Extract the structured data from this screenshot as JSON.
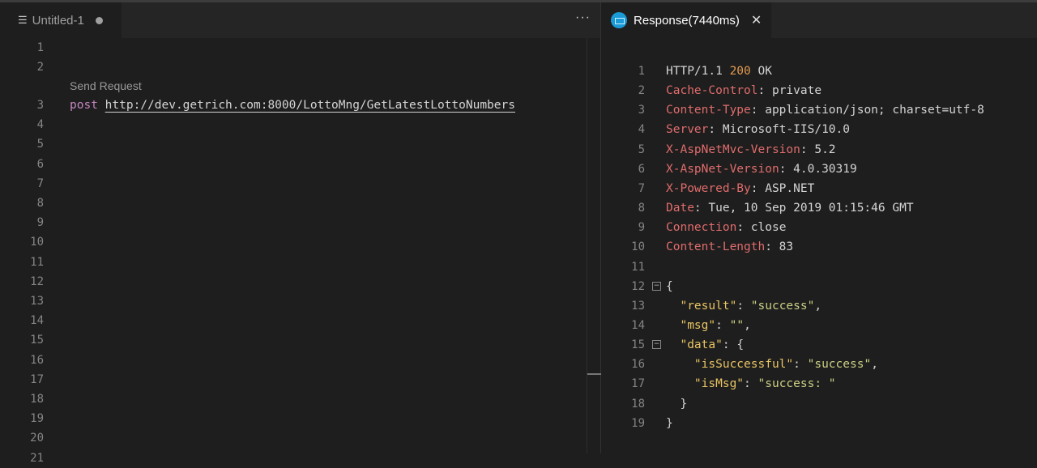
{
  "left_tab": {
    "title": "Untitled-1",
    "more": "···"
  },
  "right_tab": {
    "title": "Response(7440ms)",
    "close": "✕"
  },
  "editor": {
    "line_count": 21,
    "codelens": "Send Request",
    "method": "post",
    "url": "http://dev.getrich.com:8000/LottoMng/GetLatestLottoNumbers"
  },
  "response": {
    "lines": [
      [
        [
          "HTTP/1.1 ",
          "pl"
        ],
        [
          "200",
          "num"
        ],
        [
          " OK",
          "pl"
        ]
      ],
      [
        [
          "Cache-Control",
          "hdr"
        ],
        [
          ": private",
          "pl"
        ]
      ],
      [
        [
          "Content-Type",
          "hdr"
        ],
        [
          ": application/json; charset=utf-8",
          "pl"
        ]
      ],
      [
        [
          "Server",
          "hdr"
        ],
        [
          ": Microsoft-IIS/10.0",
          "pl"
        ]
      ],
      [
        [
          "X-AspNetMvc-Version",
          "hdr"
        ],
        [
          ": 5.2",
          "pl"
        ]
      ],
      [
        [
          "X-AspNet-Version",
          "hdr"
        ],
        [
          ": 4.0.30319",
          "pl"
        ]
      ],
      [
        [
          "X-Powered-By",
          "hdr"
        ],
        [
          ": ASP.NET",
          "pl"
        ]
      ],
      [
        [
          "Date",
          "hdr"
        ],
        [
          ": Tue, 10 Sep 2019 01:15:46 GMT",
          "pl"
        ]
      ],
      [
        [
          "Connection",
          "hdr"
        ],
        [
          ": close",
          "pl"
        ]
      ],
      [
        [
          "Content-Length",
          "hdr"
        ],
        [
          ": 83",
          "pl"
        ]
      ],
      [],
      [
        [
          "{",
          "pl"
        ]
      ],
      [
        [
          "  ",
          "pl"
        ],
        [
          "\"result\"",
          "key"
        ],
        [
          ": ",
          "pl"
        ],
        [
          "\"success\"",
          "str"
        ],
        [
          ",",
          "pl"
        ]
      ],
      [
        [
          "  ",
          "pl"
        ],
        [
          "\"msg\"",
          "key"
        ],
        [
          ": ",
          "pl"
        ],
        [
          "\"\"",
          "str"
        ],
        [
          ",",
          "pl"
        ]
      ],
      [
        [
          "  ",
          "pl"
        ],
        [
          "\"data\"",
          "key"
        ],
        [
          ": {",
          "pl"
        ]
      ],
      [
        [
          "    ",
          "pl"
        ],
        [
          "\"isSuccessful\"",
          "key"
        ],
        [
          ": ",
          "pl"
        ],
        [
          "\"success\"",
          "str"
        ],
        [
          ",",
          "pl"
        ]
      ],
      [
        [
          "    ",
          "pl"
        ],
        [
          "\"isMsg\"",
          "key"
        ],
        [
          ": ",
          "pl"
        ],
        [
          "\"success: \"",
          "str"
        ]
      ],
      [
        [
          "  }",
          "pl"
        ]
      ],
      [
        [
          "}",
          "pl"
        ]
      ]
    ],
    "fold_lines": [
      12,
      15
    ],
    "fold_glyph": "−"
  }
}
